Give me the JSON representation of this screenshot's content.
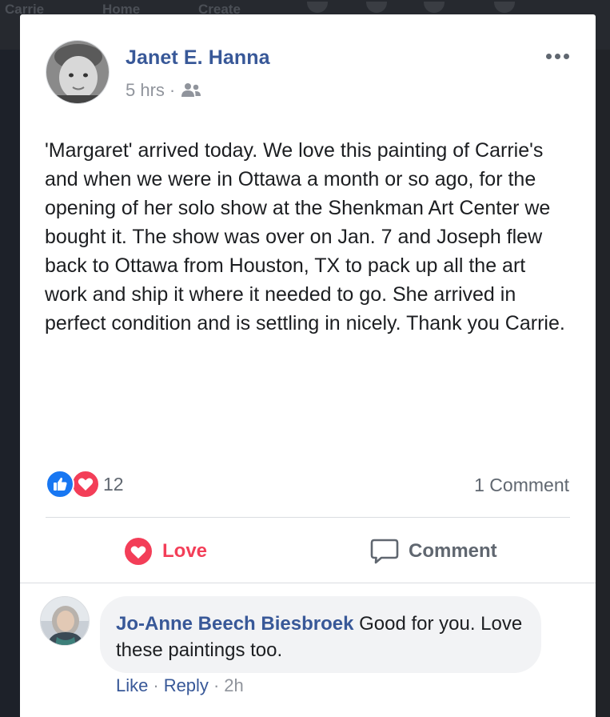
{
  "nav": {
    "ghost_items": [
      "Carrie",
      "Home",
      "Create"
    ]
  },
  "post": {
    "author": "Janet E. Hanna",
    "time": "5 hrs",
    "meta_sep": "·",
    "audience_icon": "friends-icon",
    "more_icon": "more-options-icon",
    "text": "'Margaret' arrived today. We love this painting of Carrie's and when we were in Ottawa a month or so ago, for the opening of her solo show at the Shenkman Art Center we bought it. The show was over on Jan. 7 and Joseph flew back to Ottawa from Houston, TX to pack up all the art work and ship it where it needed to go. She arrived in perfect condition and is settling in nicely. Thank you Carrie.",
    "reaction_count": "12",
    "comment_count": "1 Comment"
  },
  "actions": {
    "love_label": "Love",
    "comment_label": "Comment"
  },
  "comment": {
    "author": "Jo-Anne Beech Biesbroek",
    "text": "Good for you. Love these paintings too.",
    "like_label": "Like",
    "reply_label": "Reply",
    "sep": "·",
    "time": "2h"
  },
  "colors": {
    "link_blue": "#385898",
    "love_red": "#f33e58",
    "like_blue": "#1877f2",
    "secondary_text": "#90949c"
  }
}
